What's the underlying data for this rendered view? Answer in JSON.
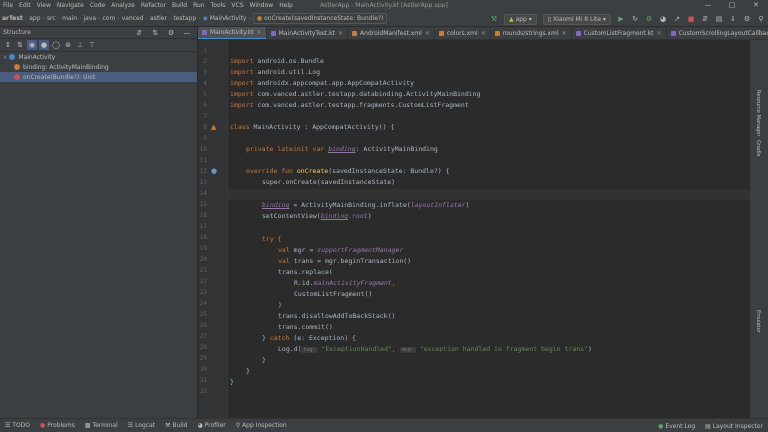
{
  "window": {
    "title": "AstlerApp - MainActivity.kt [AstlerApp.app]",
    "menus": [
      "File",
      "Edit",
      "View",
      "Navigate",
      "Code",
      "Analyze",
      "Refactor",
      "Build",
      "Run",
      "Tools",
      "VCS",
      "Window",
      "Help"
    ]
  },
  "breadcrumb": [
    "arTest",
    "app",
    "src",
    "main",
    "java",
    "com",
    "vanced",
    "astler",
    "testapp",
    "MainActivity"
  ],
  "breadcrumb_method": "onCreate(savedInstanceState: Bundle?)",
  "toolbar": {
    "module": "app",
    "device": "Xiaomi Mi 8 Lite"
  },
  "structure": {
    "title": "Structure",
    "root": "MainActivity",
    "children": [
      "binding: ActivityMainBinding",
      "onCreate(Bundle?): Unit"
    ]
  },
  "tabs": [
    "MainActivity.kt",
    "MainActivityTest.kt",
    "AndroidManifest.xml",
    "colors.xml",
    "rounds/strings.xml",
    "CustomListFragment.kt",
    "CustomScrollingLayoutCallbackWe"
  ],
  "code": {
    "line_numbers": [
      "1",
      "2",
      "3",
      "4",
      "5",
      "6",
      "7",
      "8",
      "9",
      "10",
      "11",
      "12",
      "13",
      "14",
      "15",
      "16",
      "17",
      "18",
      "19",
      "20",
      "21",
      "22",
      "23",
      "24",
      "25",
      "26",
      "27",
      "28",
      "29",
      "30",
      "31",
      "32"
    ],
    "imports": [
      "android.os.Bundle",
      "android.util.Log",
      "androidx.appcompat.app.AppCompatActivity",
      "com.vanced.astler.testapp.databinding.ActivityMainBinding",
      "com.vanced.astler.testapp.fragments.CustomListFragment"
    ],
    "kw_import": "import",
    "kw_class": "class",
    "class_name": "MainActivity : AppCompatActivity() {",
    "kw_private": "private lateinit var",
    "binding": "binding",
    "binding_type": ": ActivityMainBinding",
    "kw_override": "override fun",
    "on_create": "onCreate",
    "on_create_args": "(savedInstanceState: Bundle?) {",
    "super_call": "super.onCreate(savedInstanceState)",
    "binding_assign": " = ActivityMainBinding.inflate(",
    "layout_inflater": "layoutInflater",
    "close_paren": ")",
    "set_content_view": "setContentView(",
    "binding_root": ".root",
    "kw_try": "try {",
    "kw_val": "val",
    "mgr_decl": " mgr = ",
    "support_fm": "supportFragmentManager",
    "trans_decl": " trans = mgr.beginTransaction()",
    "trans_replace": "trans.replace(",
    "r_id": "R.id.",
    "main_activity_fragment": "mainActivityFragment",
    "comma": ",",
    "custom_list_fragment": "CustomListFragment()",
    "close_paren_line": ")",
    "disallow": "trans.disallowAddToBackStack()",
    "commit": "trans.commit()",
    "catch_open": "} ",
    "kw_catch": "catch",
    "catch_args": " (e: Exception) {",
    "log_d": "Log.d(",
    "hint_tag": "tag:",
    "str_tag": "\"ExceptionHandled\"",
    "hint_msg": "msg:",
    "str_msg": "\"exception handled in fragment begin trans\"",
    "brace": "}"
  },
  "right_strip": [
    "Resource Manager",
    "Gradle",
    "Emulator"
  ],
  "statusbar": {
    "left": [
      "TODO",
      "Problems",
      "Terminal",
      "Logcat",
      "Build",
      "Profiler",
      "App Inspection"
    ],
    "right": [
      "Event Log",
      "Layout Inspector"
    ]
  },
  "colors": {
    "accent": "#4a88c7",
    "keyword": "#cc7832",
    "function": "#ffc66d",
    "string": "#6a8759",
    "property": "#9876aa"
  }
}
